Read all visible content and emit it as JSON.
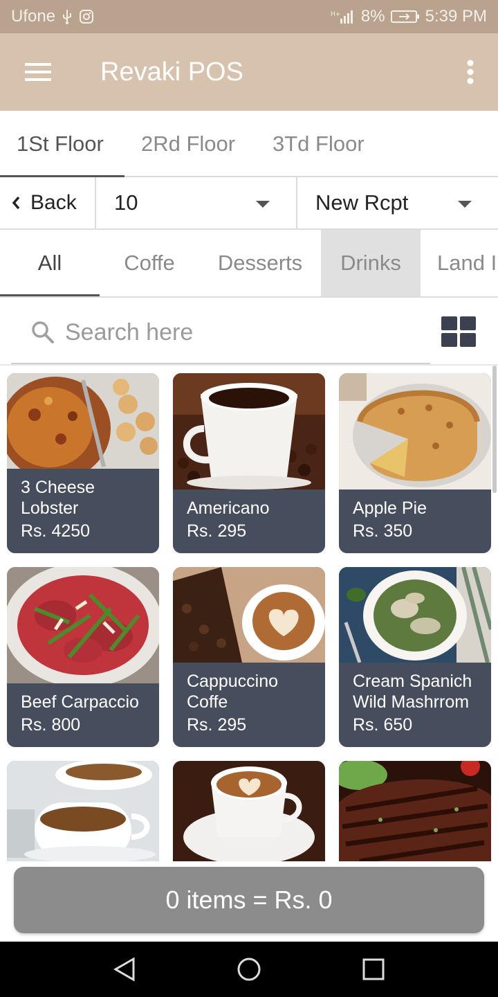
{
  "status_bar": {
    "carrier": "Ufone",
    "battery": "8%",
    "time": "5:39 PM",
    "icons": [
      "usb-icon",
      "instagram-icon",
      "signal-icon",
      "battery-icon"
    ]
  },
  "app_bar": {
    "title": "Revaki POS",
    "icons": [
      "menu-icon",
      "more-vert-icon"
    ]
  },
  "floor_tabs": [
    {
      "label": "1St Floor",
      "active": true
    },
    {
      "label": "2Rd Floor",
      "active": false
    },
    {
      "label": "3Td Floor",
      "active": false
    }
  ],
  "controls": {
    "back_label": "Back",
    "table_value": "10",
    "receipt_value": "New Rcpt"
  },
  "category_tabs": [
    {
      "label": "All",
      "active": true
    },
    {
      "label": "Coffe",
      "active": false
    },
    {
      "label": "Desserts",
      "active": false
    },
    {
      "label": "Drinks",
      "active": false,
      "pressed": true
    },
    {
      "label": "Land I",
      "active": false
    }
  ],
  "search": {
    "placeholder": "Search here",
    "value": ""
  },
  "products": [
    {
      "name_lines": [
        "3 Cheese",
        "Lobster"
      ],
      "price": "Rs. 4250",
      "image": "lobster-gratin-photo"
    },
    {
      "name_lines": [
        "Americano"
      ],
      "price": "Rs. 295",
      "image": "americano-coffee-photo"
    },
    {
      "name_lines": [
        "Apple Pie"
      ],
      "price": "Rs. 350",
      "image": "apple-pie-photo"
    },
    {
      "name_lines": [
        "Beef Carpaccio"
      ],
      "price": "Rs. 800",
      "image": "beef-carpaccio-photo"
    },
    {
      "name_lines": [
        "Cappuccino",
        "Coffe"
      ],
      "price": "Rs. 295",
      "image": "cappuccino-photo"
    },
    {
      "name_lines": [
        "Cream Spanich",
        "Wild Mashrrom"
      ],
      "price": "Rs. 650",
      "image": "creamed-spinach-photo"
    },
    {
      "name_lines": [],
      "price": "",
      "image": "espresso-cups-photo"
    },
    {
      "name_lines": [],
      "price": "",
      "image": "latte-art-photo"
    },
    {
      "name_lines": [],
      "price": "",
      "image": "grilled-steak-photo"
    }
  ],
  "cart": {
    "summary": "0 items = Rs. 0"
  },
  "colors": {
    "status_bar": "#b9a38e",
    "app_bar": "#d7c2ad",
    "card_caption": "#464d5c",
    "cart_bar": "#8c8c8c"
  }
}
